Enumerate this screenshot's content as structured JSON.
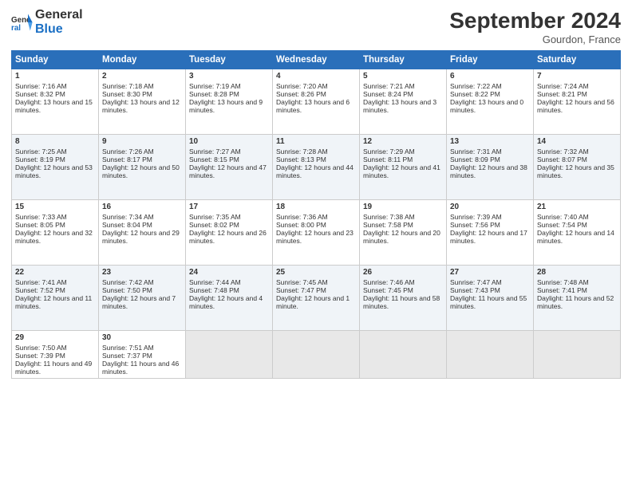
{
  "header": {
    "title": "September 2024",
    "location": "Gourdon, France"
  },
  "columns": [
    "Sunday",
    "Monday",
    "Tuesday",
    "Wednesday",
    "Thursday",
    "Friday",
    "Saturday"
  ],
  "weeks": [
    [
      {
        "day": "1",
        "sunrise": "Sunrise: 7:16 AM",
        "sunset": "Sunset: 8:32 PM",
        "daylight": "Daylight: 13 hours and 15 minutes."
      },
      {
        "day": "2",
        "sunrise": "Sunrise: 7:18 AM",
        "sunset": "Sunset: 8:30 PM",
        "daylight": "Daylight: 13 hours and 12 minutes."
      },
      {
        "day": "3",
        "sunrise": "Sunrise: 7:19 AM",
        "sunset": "Sunset: 8:28 PM",
        "daylight": "Daylight: 13 hours and 9 minutes."
      },
      {
        "day": "4",
        "sunrise": "Sunrise: 7:20 AM",
        "sunset": "Sunset: 8:26 PM",
        "daylight": "Daylight: 13 hours and 6 minutes."
      },
      {
        "day": "5",
        "sunrise": "Sunrise: 7:21 AM",
        "sunset": "Sunset: 8:24 PM",
        "daylight": "Daylight: 13 hours and 3 minutes."
      },
      {
        "day": "6",
        "sunrise": "Sunrise: 7:22 AM",
        "sunset": "Sunset: 8:22 PM",
        "daylight": "Daylight: 13 hours and 0 minutes."
      },
      {
        "day": "7",
        "sunrise": "Sunrise: 7:24 AM",
        "sunset": "Sunset: 8:21 PM",
        "daylight": "Daylight: 12 hours and 56 minutes."
      }
    ],
    [
      {
        "day": "8",
        "sunrise": "Sunrise: 7:25 AM",
        "sunset": "Sunset: 8:19 PM",
        "daylight": "Daylight: 12 hours and 53 minutes."
      },
      {
        "day": "9",
        "sunrise": "Sunrise: 7:26 AM",
        "sunset": "Sunset: 8:17 PM",
        "daylight": "Daylight: 12 hours and 50 minutes."
      },
      {
        "day": "10",
        "sunrise": "Sunrise: 7:27 AM",
        "sunset": "Sunset: 8:15 PM",
        "daylight": "Daylight: 12 hours and 47 minutes."
      },
      {
        "day": "11",
        "sunrise": "Sunrise: 7:28 AM",
        "sunset": "Sunset: 8:13 PM",
        "daylight": "Daylight: 12 hours and 44 minutes."
      },
      {
        "day": "12",
        "sunrise": "Sunrise: 7:29 AM",
        "sunset": "Sunset: 8:11 PM",
        "daylight": "Daylight: 12 hours and 41 minutes."
      },
      {
        "day": "13",
        "sunrise": "Sunrise: 7:31 AM",
        "sunset": "Sunset: 8:09 PM",
        "daylight": "Daylight: 12 hours and 38 minutes."
      },
      {
        "day": "14",
        "sunrise": "Sunrise: 7:32 AM",
        "sunset": "Sunset: 8:07 PM",
        "daylight": "Daylight: 12 hours and 35 minutes."
      }
    ],
    [
      {
        "day": "15",
        "sunrise": "Sunrise: 7:33 AM",
        "sunset": "Sunset: 8:05 PM",
        "daylight": "Daylight: 12 hours and 32 minutes."
      },
      {
        "day": "16",
        "sunrise": "Sunrise: 7:34 AM",
        "sunset": "Sunset: 8:04 PM",
        "daylight": "Daylight: 12 hours and 29 minutes."
      },
      {
        "day": "17",
        "sunrise": "Sunrise: 7:35 AM",
        "sunset": "Sunset: 8:02 PM",
        "daylight": "Daylight: 12 hours and 26 minutes."
      },
      {
        "day": "18",
        "sunrise": "Sunrise: 7:36 AM",
        "sunset": "Sunset: 8:00 PM",
        "daylight": "Daylight: 12 hours and 23 minutes."
      },
      {
        "day": "19",
        "sunrise": "Sunrise: 7:38 AM",
        "sunset": "Sunset: 7:58 PM",
        "daylight": "Daylight: 12 hours and 20 minutes."
      },
      {
        "day": "20",
        "sunrise": "Sunrise: 7:39 AM",
        "sunset": "Sunset: 7:56 PM",
        "daylight": "Daylight: 12 hours and 17 minutes."
      },
      {
        "day": "21",
        "sunrise": "Sunrise: 7:40 AM",
        "sunset": "Sunset: 7:54 PM",
        "daylight": "Daylight: 12 hours and 14 minutes."
      }
    ],
    [
      {
        "day": "22",
        "sunrise": "Sunrise: 7:41 AM",
        "sunset": "Sunset: 7:52 PM",
        "daylight": "Daylight: 12 hours and 11 minutes."
      },
      {
        "day": "23",
        "sunrise": "Sunrise: 7:42 AM",
        "sunset": "Sunset: 7:50 PM",
        "daylight": "Daylight: 12 hours and 7 minutes."
      },
      {
        "day": "24",
        "sunrise": "Sunrise: 7:44 AM",
        "sunset": "Sunset: 7:48 PM",
        "daylight": "Daylight: 12 hours and 4 minutes."
      },
      {
        "day": "25",
        "sunrise": "Sunrise: 7:45 AM",
        "sunset": "Sunset: 7:47 PM",
        "daylight": "Daylight: 12 hours and 1 minute."
      },
      {
        "day": "26",
        "sunrise": "Sunrise: 7:46 AM",
        "sunset": "Sunset: 7:45 PM",
        "daylight": "Daylight: 11 hours and 58 minutes."
      },
      {
        "day": "27",
        "sunrise": "Sunrise: 7:47 AM",
        "sunset": "Sunset: 7:43 PM",
        "daylight": "Daylight: 11 hours and 55 minutes."
      },
      {
        "day": "28",
        "sunrise": "Sunrise: 7:48 AM",
        "sunset": "Sunset: 7:41 PM",
        "daylight": "Daylight: 11 hours and 52 minutes."
      }
    ],
    [
      {
        "day": "29",
        "sunrise": "Sunrise: 7:50 AM",
        "sunset": "Sunset: 7:39 PM",
        "daylight": "Daylight: 11 hours and 49 minutes."
      },
      {
        "day": "30",
        "sunrise": "Sunrise: 7:51 AM",
        "sunset": "Sunset: 7:37 PM",
        "daylight": "Daylight: 11 hours and 46 minutes."
      },
      null,
      null,
      null,
      null,
      null
    ]
  ]
}
